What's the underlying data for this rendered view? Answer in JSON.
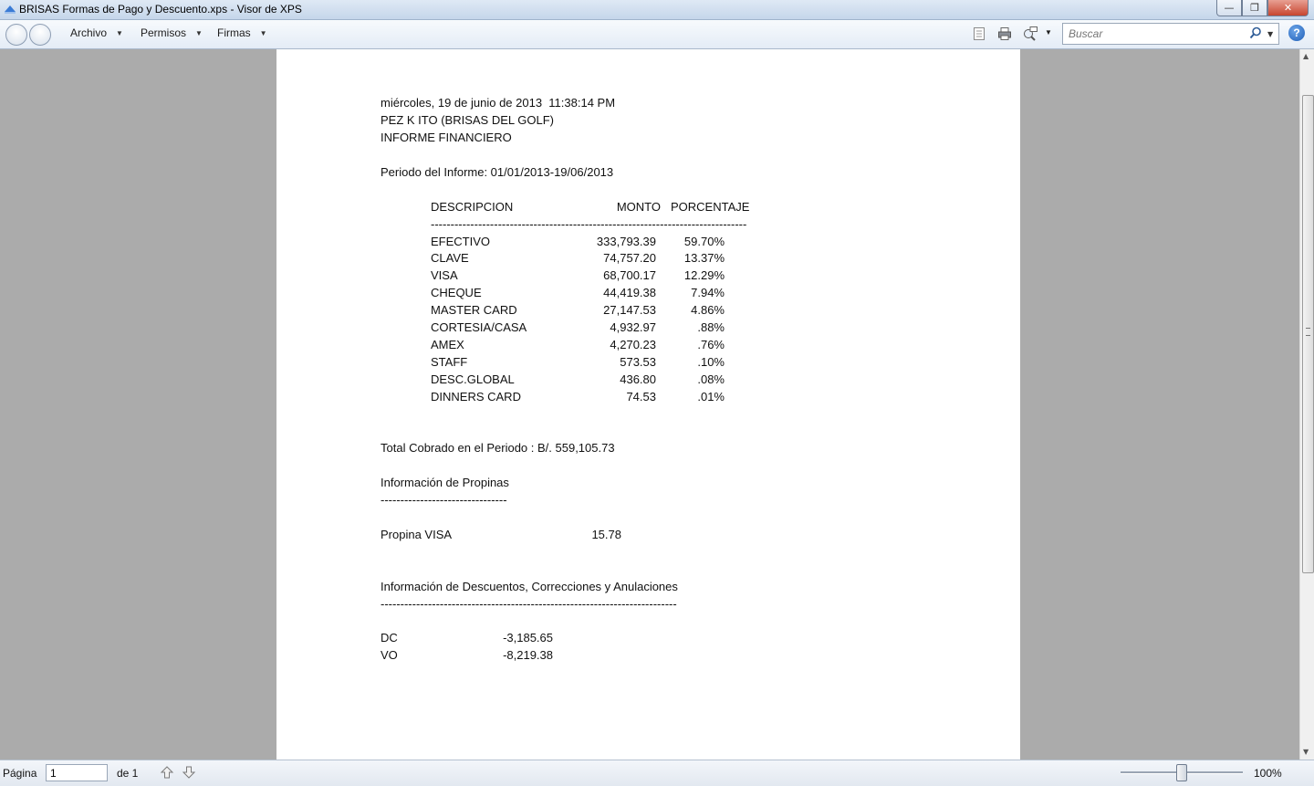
{
  "window": {
    "title": "BRISAS Formas de Pago y Descuento.xps - Visor de XPS"
  },
  "toolbar": {
    "menus": [
      "Archivo",
      "Permisos",
      "Firmas"
    ],
    "search_placeholder": "Buscar",
    "help_label": "?"
  },
  "report": {
    "header_lines": [
      "miércoles, 19 de junio de 2013  11:38:14 PM",
      "PEZ K ITO (BRISAS DEL GOLF)",
      "INFORME FINANCIERO"
    ],
    "period": "Periodo del Informe: 01/01/2013-19/06/2013",
    "columns": {
      "description": "DESCRIPCION",
      "amount": "MONTO",
      "percent": "PORCENTAJE"
    },
    "separator": "--------------------------------------------------------------------------------",
    "rows": [
      {
        "desc": "EFECTIVO",
        "amount": "333,793.39",
        "pct": "59.70%"
      },
      {
        "desc": "CLAVE",
        "amount": "74,757.20",
        "pct": "13.37%"
      },
      {
        "desc": "VISA",
        "amount": "68,700.17",
        "pct": "12.29%"
      },
      {
        "desc": "CHEQUE",
        "amount": "44,419.38",
        "pct": "7.94%"
      },
      {
        "desc": "MASTER CARD",
        "amount": "27,147.53",
        "pct": "4.86%"
      },
      {
        "desc": "CORTESIA/CASA",
        "amount": "4,932.97",
        "pct": ".88%"
      },
      {
        "desc": "AMEX",
        "amount": "4,270.23",
        "pct": ".76%"
      },
      {
        "desc": "STAFF",
        "amount": "573.53",
        "pct": ".10%"
      },
      {
        "desc": "DESC.GLOBAL",
        "amount": "436.80",
        "pct": ".08%"
      },
      {
        "desc": "DINNERS CARD",
        "amount": "74.53",
        "pct": ".01%"
      }
    ],
    "total": "Total Cobrado en el Periodo : B/. 559,105.73",
    "tips": {
      "heading": "Información de Propinas",
      "separator": "--------------------------------",
      "label": "Propina VISA",
      "value": "15.78"
    },
    "discounts": {
      "heading": "Información de Descuentos, Correcciones y Anulaciones",
      "separator": "---------------------------------------------------------------------------",
      "rows": [
        {
          "code": "DC",
          "value": "-3,185.65"
        },
        {
          "code": "VO",
          "value": "-8,219.38"
        }
      ]
    }
  },
  "statusbar": {
    "page_label": "Página",
    "page_value": "1",
    "page_of": "de 1",
    "zoom": "100%"
  }
}
